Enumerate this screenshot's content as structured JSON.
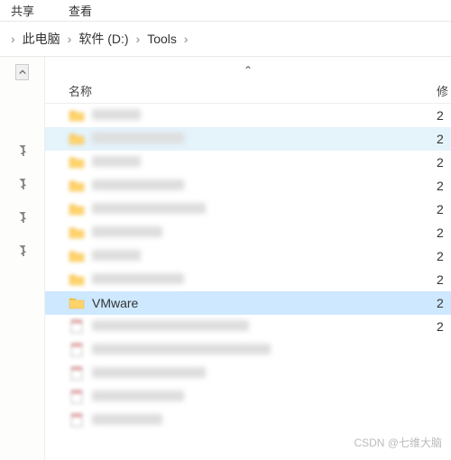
{
  "toolbar": {
    "share": "共享",
    "view": "查看"
  },
  "breadcrumb": {
    "items": [
      "此电脑",
      "软件 (D:)",
      "Tools"
    ]
  },
  "sidebar": {
    "pins": [
      true,
      true,
      true,
      true
    ]
  },
  "columns": {
    "name": "名称",
    "modified": "修"
  },
  "rows": [
    {
      "type": "folder",
      "label": "████",
      "date": "2",
      "state": "blur"
    },
    {
      "type": "folder",
      "label": "████████████",
      "date": "2",
      "state": "hover-blur"
    },
    {
      "type": "folder",
      "label": "████",
      "date": "2",
      "state": "blur"
    },
    {
      "type": "folder",
      "label": "████████████",
      "date": "2",
      "state": "blur"
    },
    {
      "type": "folder",
      "label": "████████████████",
      "date": "2",
      "state": "blur"
    },
    {
      "type": "folder",
      "label": "████████",
      "date": "2",
      "state": "blur"
    },
    {
      "type": "folder",
      "label": "████",
      "date": "2",
      "state": "blur"
    },
    {
      "type": "folder",
      "label": "████████████",
      "date": "2",
      "state": "blur"
    },
    {
      "type": "folder",
      "label": "VMware",
      "date": "2",
      "state": "selected"
    },
    {
      "type": "file",
      "label": "████████████████████████",
      "date": "2",
      "state": "blur"
    },
    {
      "type": "file",
      "label": "████████████████████████████",
      "date": "",
      "state": "blur"
    },
    {
      "type": "file",
      "label": "████████████████",
      "date": "",
      "state": "blur"
    },
    {
      "type": "file",
      "label": "████████████",
      "date": "",
      "state": "blur"
    },
    {
      "type": "file",
      "label": "████████",
      "date": "",
      "state": "blur"
    }
  ],
  "watermark": "CSDN @七维大脑"
}
